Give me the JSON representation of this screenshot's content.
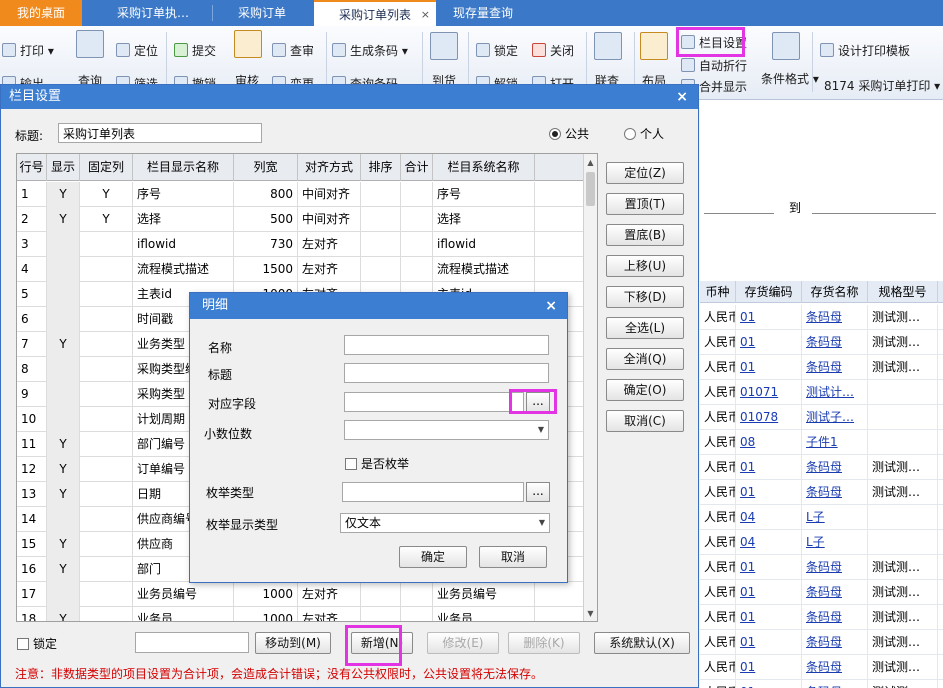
{
  "tabs": {
    "home": "我的桌面",
    "t1": "采购订单执…",
    "t2": "采购订单",
    "t3": "采购订单列表",
    "t4": "现存量查询",
    "close_glyph": "×"
  },
  "ribbon": {
    "print": "打印",
    "export": "输出",
    "query": "查询",
    "locate": "定位",
    "filter": "筛选",
    "submit": "提交",
    "withdraw": "撤销",
    "review": "审核",
    "audit": "查审",
    "change": "变更",
    "gen_barcode": "生成条码",
    "barcode_query": "查询条码",
    "arrival": "到货",
    "lock": "锁定",
    "unlock": "解锁",
    "close": "关闭",
    "open": "打开",
    "join_query": "联查",
    "layout": "布局",
    "column_settings": "栏目设置",
    "auto_wrap": "自动折行",
    "merge_display": "合并显示",
    "cond_format": "条件格式",
    "design_print": "设计打印模板",
    "template_select": "8174 采购订单打印"
  },
  "right_panel": {
    "range_to": "到",
    "headers": [
      "币种",
      "存货编码",
      "存货名称",
      "规格型号"
    ],
    "rows": [
      [
        "人民币",
        "01",
        "条码母",
        "测试测…"
      ],
      [
        "人民币",
        "01",
        "条码母",
        "测试测…"
      ],
      [
        "人民币",
        "01",
        "条码母",
        "测试测…"
      ],
      [
        "人民币",
        "01071",
        "测试计…",
        ""
      ],
      [
        "人民币",
        "01078",
        "测试子…",
        ""
      ],
      [
        "人民币",
        "08",
        "子件1",
        ""
      ],
      [
        "人民币",
        "01",
        "条码母",
        "测试测…"
      ],
      [
        "人民币",
        "01",
        "条码母",
        "测试测…"
      ],
      [
        "人民币",
        "04",
        "L子",
        ""
      ],
      [
        "人民币",
        "04",
        "L子",
        ""
      ],
      [
        "人民币",
        "01",
        "条码母",
        "测试测…"
      ],
      [
        "人民币",
        "01",
        "条码母",
        "测试测…"
      ],
      [
        "人民币",
        "01",
        "条码母",
        "测试测…"
      ],
      [
        "人民币",
        "01",
        "条码母",
        "测试测…"
      ],
      [
        "人民币",
        "01",
        "条码母",
        "测试测…"
      ],
      [
        "人民币",
        "01",
        "条码母",
        "测试测…"
      ]
    ]
  },
  "dialog": {
    "title": "栏目设置",
    "close_glyph": "×",
    "title_label": "标题:",
    "title_value": "采购订单列表",
    "radio_public": "公共",
    "radio_private": "个人",
    "columns": [
      "行号",
      "显示",
      "固定列",
      "栏目显示名称",
      "列宽",
      "对齐方式",
      "排序",
      "合计",
      "栏目系统名称"
    ],
    "rows": [
      [
        "1",
        "Y",
        "Y",
        "序号",
        "800",
        "中间对齐",
        "",
        "",
        "序号"
      ],
      [
        "2",
        "Y",
        "Y",
        "选择",
        "500",
        "中间对齐",
        "",
        "",
        "选择"
      ],
      [
        "3",
        "",
        "",
        "iflowid",
        "730",
        "左对齐",
        "",
        "",
        "iflowid"
      ],
      [
        "4",
        "",
        "",
        "流程模式描述",
        "1500",
        "左对齐",
        "",
        "",
        "流程模式描述"
      ],
      [
        "5",
        "",
        "",
        "主表id",
        "1000",
        "左对齐",
        "",
        "",
        "主表id"
      ],
      [
        "6",
        "",
        "",
        "时间戳",
        "",
        "",
        "",
        "",
        ""
      ],
      [
        "7",
        "Y",
        "",
        "业务类型",
        "",
        "",
        "",
        "",
        ""
      ],
      [
        "8",
        "",
        "",
        "采购类型编",
        "",
        "",
        "",
        "",
        ""
      ],
      [
        "9",
        "",
        "",
        "采购类型",
        "",
        "",
        "",
        "",
        ""
      ],
      [
        "10",
        "",
        "",
        "计划周期",
        "",
        "",
        "",
        "",
        ""
      ],
      [
        "11",
        "Y",
        "",
        "部门编号",
        "",
        "",
        "",
        "",
        ""
      ],
      [
        "12",
        "Y",
        "",
        "订单编号",
        "",
        "",
        "",
        "",
        ""
      ],
      [
        "13",
        "Y",
        "",
        "日期",
        "",
        "",
        "",
        "",
        ""
      ],
      [
        "14",
        "",
        "",
        "供应商编号",
        "",
        "",
        "",
        "",
        ""
      ],
      [
        "15",
        "Y",
        "",
        "供应商",
        "",
        "",
        "",
        "",
        ""
      ],
      [
        "16",
        "Y",
        "",
        "部门",
        "",
        "",
        "",
        "",
        ""
      ],
      [
        "17",
        "",
        "",
        "业务员编号",
        "1000",
        "左对齐",
        "",
        "",
        "业务员编号"
      ],
      [
        "18",
        "Y",
        "",
        "业务员",
        "1000",
        "左对齐",
        "",
        "",
        "业务员"
      ]
    ],
    "side_buttons": [
      "定位(Z)",
      "置顶(T)",
      "置底(B)",
      "上移(U)",
      "下移(D)",
      "全选(L)",
      "全消(Q)",
      "确定(O)",
      "取消(C)"
    ],
    "lock_label": "锁定",
    "move_to_input": "",
    "move_to": "移动到(M)",
    "add": "新增(N)",
    "modify": "修改(E)",
    "delete": "删除(K)",
    "sys_default": "系统默认(X)",
    "notice": "注意：非数据类型的项目设置为合计项，会造成合计错误；没有公共权限时，公共设置将无法保存。"
  },
  "detail": {
    "title": "明细",
    "close_glyph": "×",
    "name_label": "名称",
    "name_value": "",
    "caption_label": "标题",
    "caption_value": "",
    "field_label": "对应字段",
    "field_value": "",
    "decimals_label": "小数位数",
    "decimals_value": "",
    "is_enum_label": "是否枚举",
    "enum_type_label": "枚举类型",
    "enum_type_value": "",
    "enum_display_label": "枚举显示类型",
    "enum_display_value": "仅文本",
    "browse_glyph": "...",
    "ok": "确定",
    "cancel": "取消"
  },
  "colors": {
    "tab_bar": "#3b78c7",
    "home_tab": "#f08a1c",
    "dialog_title": "#3c7ed1",
    "highlight": "#e334e3",
    "notice_text": "#d40000",
    "link": "#1a3cb0"
  },
  "icons": [
    "print-icon",
    "query-icon",
    "locate-icon",
    "submit-icon",
    "review-icon",
    "audit-icon",
    "barcode-icon",
    "arrival-icon",
    "lock-icon",
    "close-icon",
    "join-query-icon",
    "layout-icon",
    "column-settings-icon",
    "cond-format-icon",
    "print-template-icon"
  ]
}
